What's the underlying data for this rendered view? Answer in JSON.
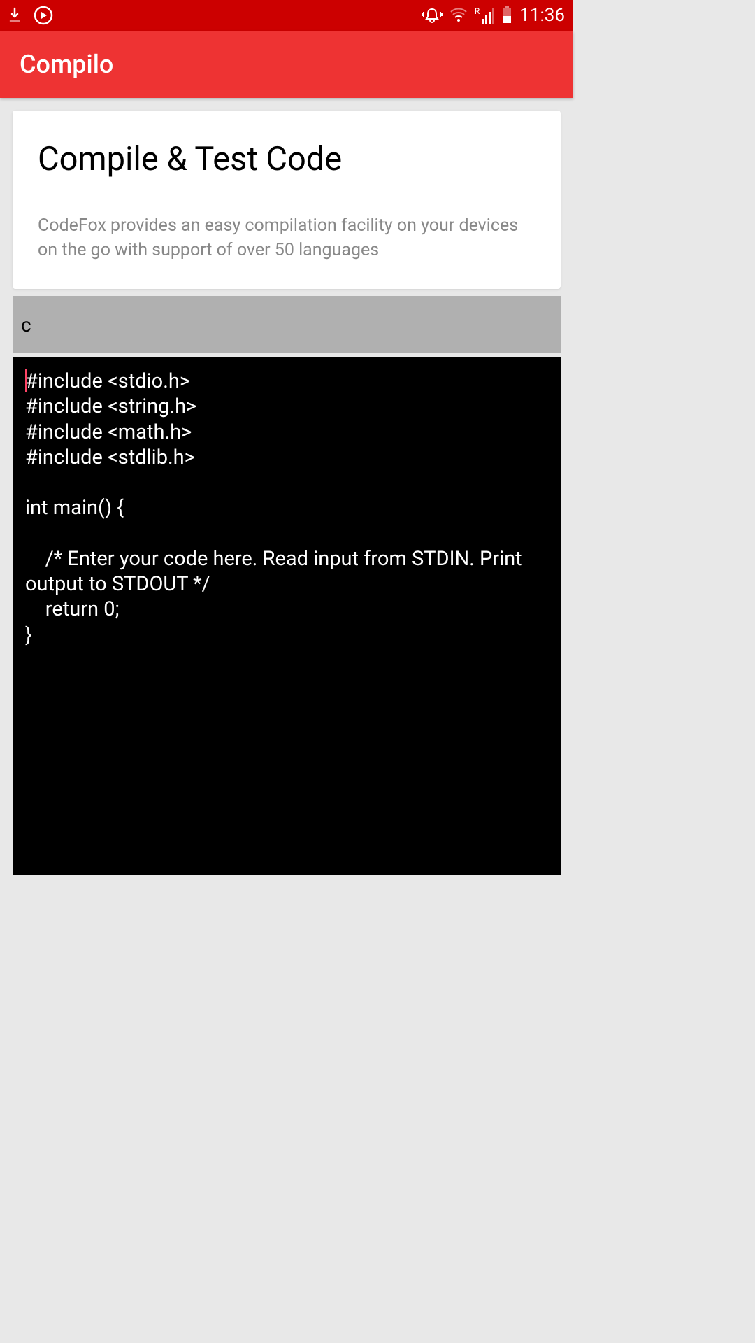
{
  "statusBar": {
    "time": "11:36",
    "signalLabel": "R"
  },
  "header": {
    "appTitle": "Compilo"
  },
  "card": {
    "title": "Compile & Test Code",
    "description": "CodeFox provides an easy compilation facility on your devices on the go with support of over 50 languages"
  },
  "languageSelector": {
    "selected": "c"
  },
  "codeEditor": {
    "content": "#include <stdio.h>\n#include <string.h>\n#include <math.h>\n#include <stdlib.h>\n\nint main() {\n\n    /* Enter your code here. Read input from STDIN. Print output to STDOUT */\n    return 0;\n}"
  }
}
